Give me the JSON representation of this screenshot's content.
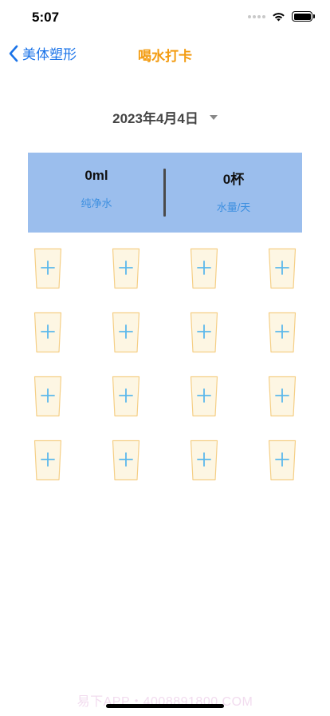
{
  "status_bar": {
    "time": "5:07"
  },
  "nav": {
    "back_label": "美体塑形",
    "title": "喝水打卡"
  },
  "date_picker": {
    "date": "2023年4月4日"
  },
  "summary": {
    "volume_value": "0ml",
    "volume_label": "纯净水",
    "cups_value": "0杯",
    "cups_label": "水量/天"
  },
  "cups": {
    "rows": 4,
    "per_row": 4,
    "cup_fill": "#fdf6e3",
    "cup_stroke": "#f5cf86",
    "plus_color": "#5bb8ec"
  },
  "watermark": "易下APP・4008891800.COM",
  "colors": {
    "accent_blue": "#1a73e8",
    "title_orange": "#f39c12",
    "card_bg": "#9bbeed"
  }
}
